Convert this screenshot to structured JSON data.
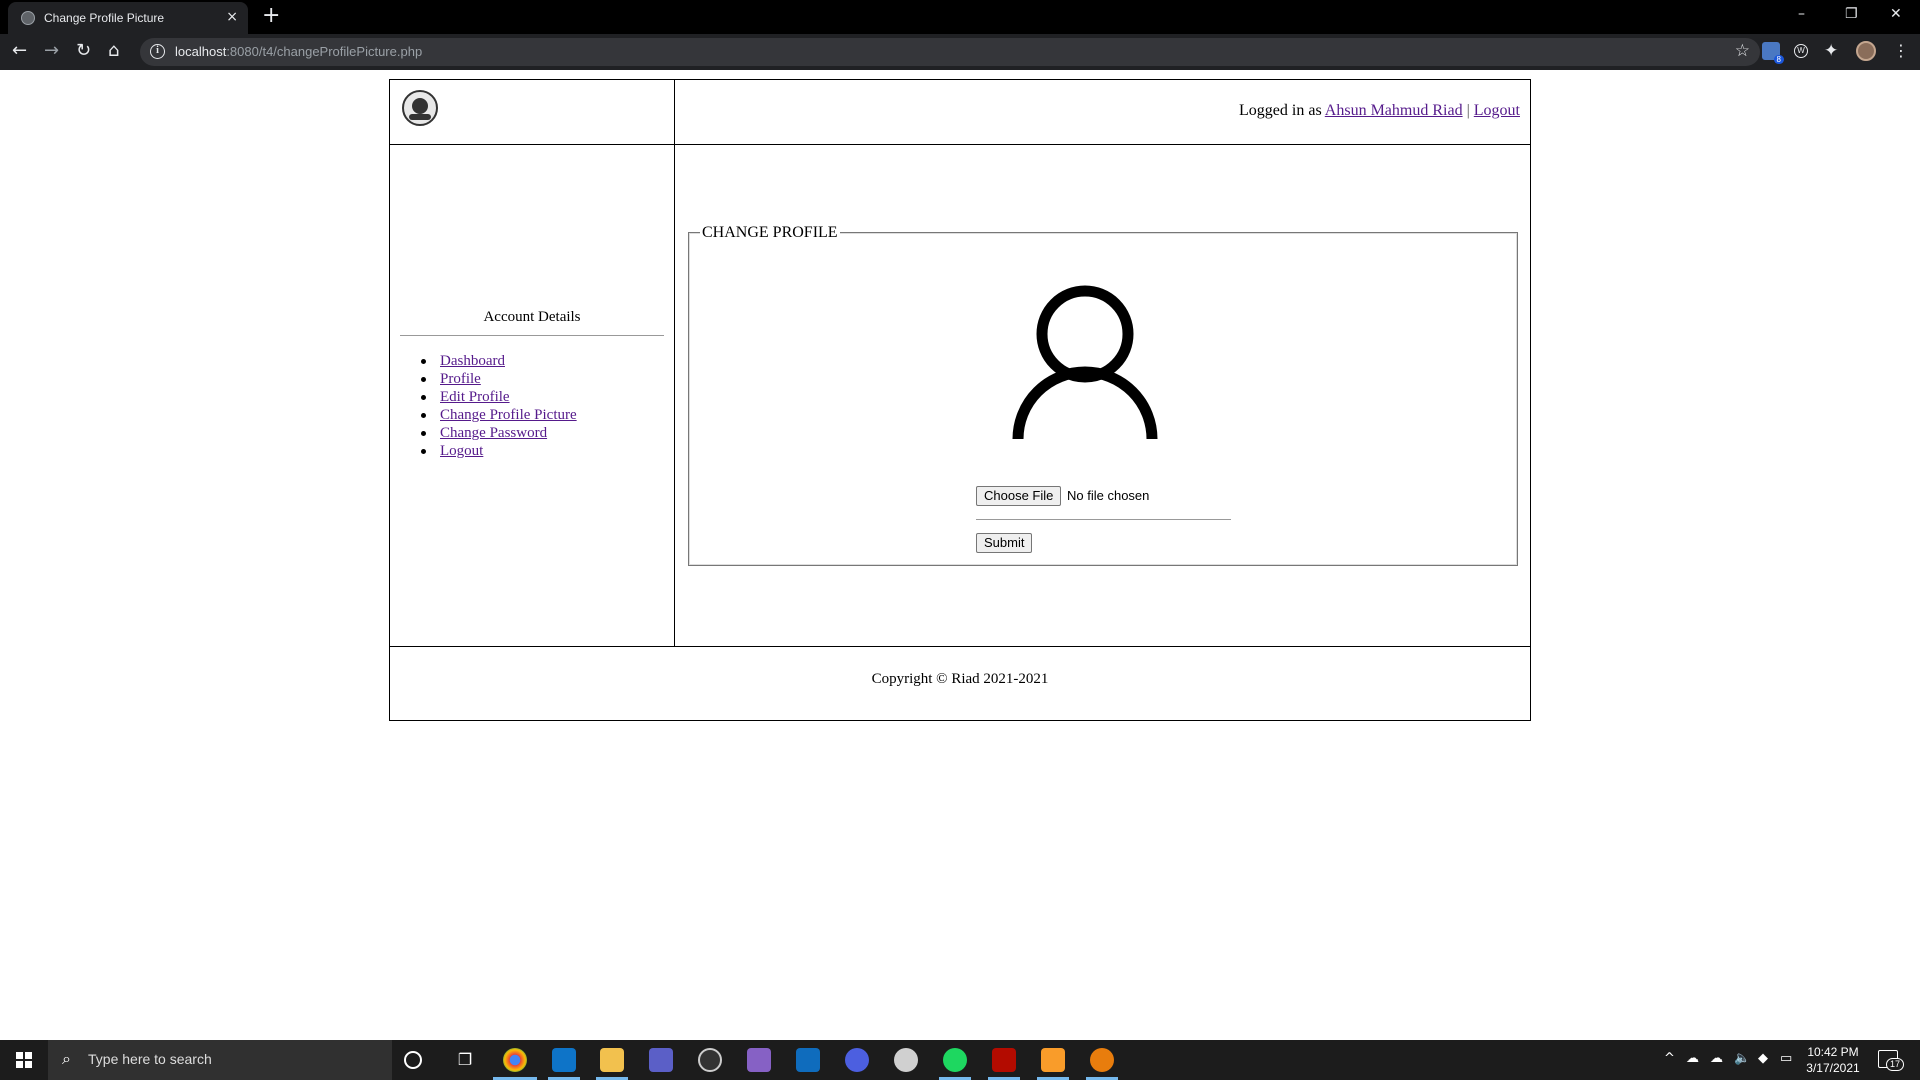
{
  "browser": {
    "tab_title": "Change Profile Picture",
    "tab_close": "×",
    "new_tab": "+",
    "url_host": "localhost",
    "url_rest": ":8080/t4/changeProfilePicture.php",
    "extension_badge": "8",
    "window_controls": {
      "minimize": "–",
      "restore": "❐",
      "close": "✕"
    }
  },
  "header": {
    "logged_in_prefix": "Logged in as",
    "user_name": "Ahsun Mahmud Riad",
    "separator": "|",
    "logout_label": "Logout"
  },
  "sidebar": {
    "title": "Account Details",
    "items": [
      {
        "label": "Dashboard"
      },
      {
        "label": "Profile"
      },
      {
        "label": "Edit Profile"
      },
      {
        "label": "Change Profile Picture"
      },
      {
        "label": "Change Password"
      },
      {
        "label": "Logout"
      }
    ]
  },
  "form": {
    "legend": "CHANGE PROFILE",
    "choose_file_label": "Choose File",
    "file_status": "No file chosen",
    "submit_label": "Submit"
  },
  "footer": {
    "copyright": "Copyright © Riad 2021-2021"
  },
  "taskbar": {
    "search_placeholder": "Type here to search",
    "time": "10:42 PM",
    "date": "3/17/2021",
    "notification_count": "17",
    "apps": [
      "chrome-icon",
      "vscode-icon",
      "file-explorer-icon",
      "teams-icon",
      "obs-icon",
      "visual-studio-icon",
      "outlook-icon",
      "firefox-icon",
      "app-icon",
      "spotify-icon",
      "acrobat-icon",
      "sublime-text-icon",
      "blender-icon"
    ]
  },
  "colors": {
    "link_visited": "#551a8b",
    "taskbar_bg": "#1c1c1c",
    "browser_toolbar": "#202124"
  }
}
